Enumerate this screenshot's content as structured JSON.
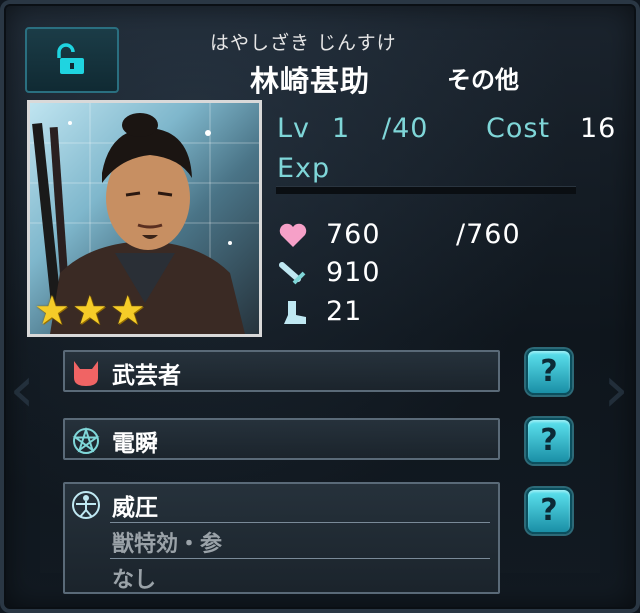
{
  "furigana": "はやしざき じんすけ",
  "name": "林崎甚助",
  "category": "その他",
  "level": {
    "label": "Lv",
    "value": "1",
    "max": "/40"
  },
  "cost": {
    "label": "Cost",
    "value": "16"
  },
  "exp": {
    "label": "Exp",
    "fraction": 0.0
  },
  "hp": {
    "current": "760",
    "max": "/760",
    "icon": "heart-icon"
  },
  "attack": {
    "value": "910",
    "icon": "sword-icon"
  },
  "speed": {
    "value": "21",
    "icon": "boot-icon"
  },
  "rarity_stars": 3,
  "skills": [
    {
      "name": "武芸者",
      "icon": "demon-helmet-icon",
      "help": "?"
    },
    {
      "name": "電瞬",
      "icon": "pentagram-icon",
      "help": "?"
    },
    {
      "name": "威圧",
      "icon": "vitruvian-icon",
      "help": "?",
      "sub": [
        "獣特効・参",
        "なし"
      ]
    }
  ],
  "colors": {
    "accent": "#7fd6d8",
    "star": "#f5cc28",
    "heart": "#f6a0c8",
    "button": "#5de3ef"
  }
}
